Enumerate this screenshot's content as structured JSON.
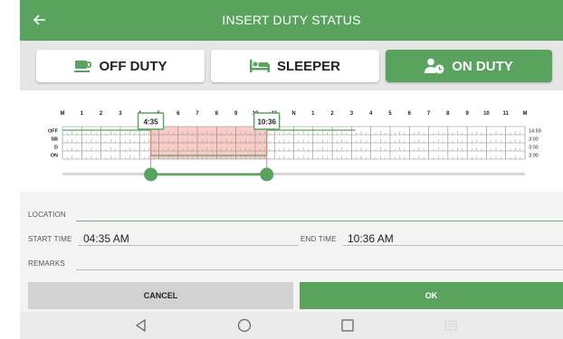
{
  "header": {
    "title": "INSERT DUTY STATUS",
    "back_icon": "arrow-left-icon"
  },
  "status_buttons": [
    {
      "label": "OFF DUTY",
      "icon": "coffee-cup-icon",
      "active": false
    },
    {
      "label": "SLEEPER",
      "icon": "bed-icon",
      "active": false
    },
    {
      "label": "ON DUTY",
      "icon": "user-clock-icon",
      "active": true
    }
  ],
  "chart": {
    "hour_labels": [
      "M",
      "1",
      "2",
      "3",
      "4",
      "5",
      "6",
      "7",
      "8",
      "9",
      "10",
      "11",
      "N",
      "1",
      "2",
      "3",
      "4",
      "5",
      "6",
      "7",
      "8",
      "9",
      "10",
      "11",
      "M"
    ],
    "rows": [
      "OFF",
      "SB",
      "D",
      "ON"
    ],
    "totals": [
      "14:59",
      "3:00",
      "3:00",
      "3:00"
    ],
    "selection_start": "4:35",
    "selection_end": "10:36",
    "selection_start_hours": 4.583,
    "selection_end_hours": 10.6
  },
  "form": {
    "location_label": "LOCATION",
    "location_value": "",
    "start_time_label": "START TIME",
    "start_time_value": "04:35 AM",
    "end_time_label": "END TIME",
    "end_time_value": "10:36 AM",
    "remarks_label": "REMARKS",
    "remarks_value": ""
  },
  "actions": {
    "cancel_label": "CANCEL",
    "ok_label": "OK"
  },
  "navbar": {
    "icons": [
      "back-triangle-icon",
      "home-circle-icon",
      "recents-square-icon",
      "keyboard-icon"
    ]
  },
  "colors": {
    "primary": "#5aa35e",
    "selection": "#f7c4be",
    "selection_border": "#e88a80"
  }
}
